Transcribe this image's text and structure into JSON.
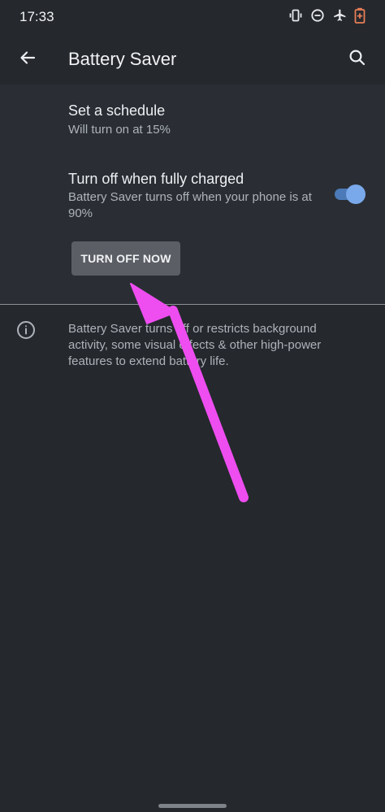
{
  "status_bar": {
    "time": "17:33",
    "icons": [
      "vibrate-icon",
      "do-not-disturb-icon",
      "airplane-icon",
      "battery-saver-icon"
    ]
  },
  "app_bar": {
    "title": "Battery Saver",
    "back_icon": "arrow-back-icon",
    "search_icon": "search-icon"
  },
  "settings": {
    "schedule": {
      "title": "Set a schedule",
      "summary": "Will turn on at 15%"
    },
    "fully_charged": {
      "title": "Turn off when fully charged",
      "summary": "Battery Saver turns off when your phone is at 90%",
      "enabled": true
    },
    "turn_off_button": "TURN OFF NOW"
  },
  "footer": {
    "info_icon": "info-icon",
    "text": "Battery Saver turns off or restricts background activity, some visual effects & other high-power features to extend battery life."
  },
  "colors": {
    "background": "#25282d",
    "panel": "#2a2e34",
    "accent": "#79a9eb",
    "annotation_arrow": "#ee4df0"
  }
}
